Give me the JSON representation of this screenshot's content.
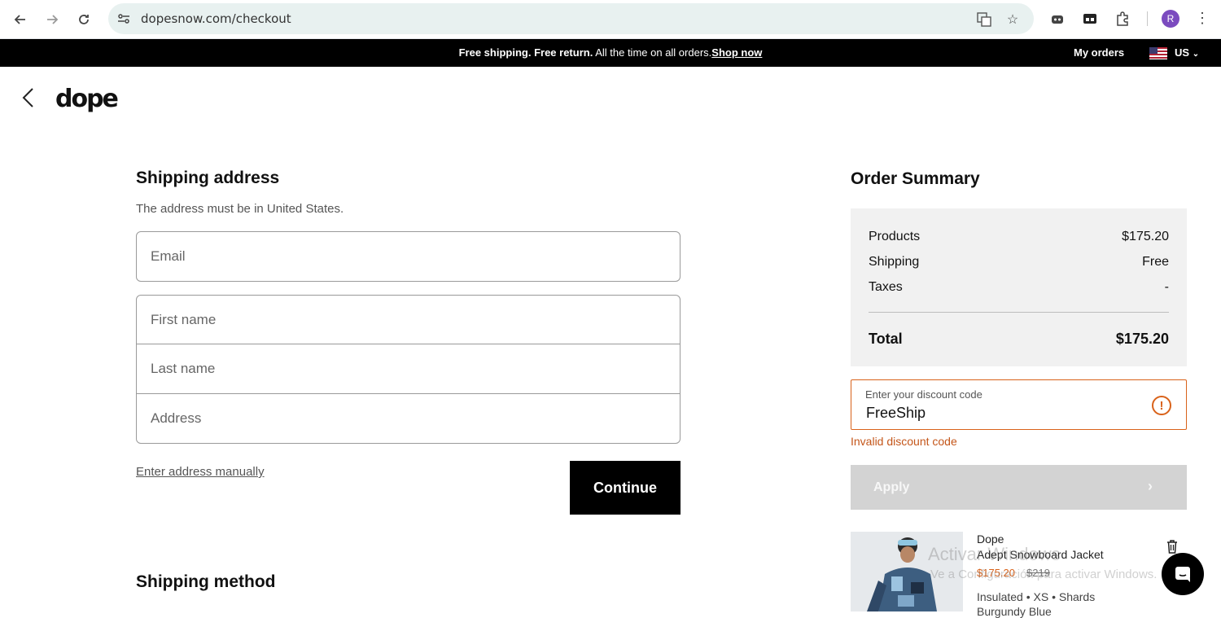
{
  "browser": {
    "url": "dopesnow.com/checkout",
    "profile_initial": "R"
  },
  "promo": {
    "bold_text": "Free shipping. Free return.",
    "text": " All the time on all orders.",
    "link": "Shop now",
    "my_orders": "My orders",
    "locale": "US"
  },
  "header": {
    "logo": "dope"
  },
  "shipping": {
    "title": "Shipping address",
    "subtitle": "The address must be in United States.",
    "email_placeholder": "Email",
    "first_name_placeholder": "First name",
    "last_name_placeholder": "Last name",
    "address_placeholder": "Address",
    "manual_link": "Enter address manually",
    "continue_label": "Continue",
    "method_title": "Shipping method"
  },
  "summary": {
    "title": "Order Summary",
    "rows": [
      {
        "label": "Products",
        "value": "$175.20"
      },
      {
        "label": "Shipping",
        "value": "Free"
      },
      {
        "label": "Taxes",
        "value": "-"
      }
    ],
    "total_label": "Total",
    "total_value": "$175.20"
  },
  "discount": {
    "label": "Enter your discount code",
    "value": "FreeShip",
    "error": "Invalid discount code",
    "apply_label": "Apply"
  },
  "product": {
    "brand": "Dope",
    "name": "Adept Snowboard Jacket",
    "sale_price": "$175.20",
    "original_price": "$219",
    "variant": "Insulated • XS • Shards",
    "color": "Burgundy Blue"
  },
  "watermark": {
    "line1": "Activar Windows",
    "line2": "Ve a Configuración para activar Windows."
  },
  "colors": {
    "accent": "#d9621a",
    "promo_bg": "#000000",
    "summary_bg": "#f1f1f1"
  }
}
